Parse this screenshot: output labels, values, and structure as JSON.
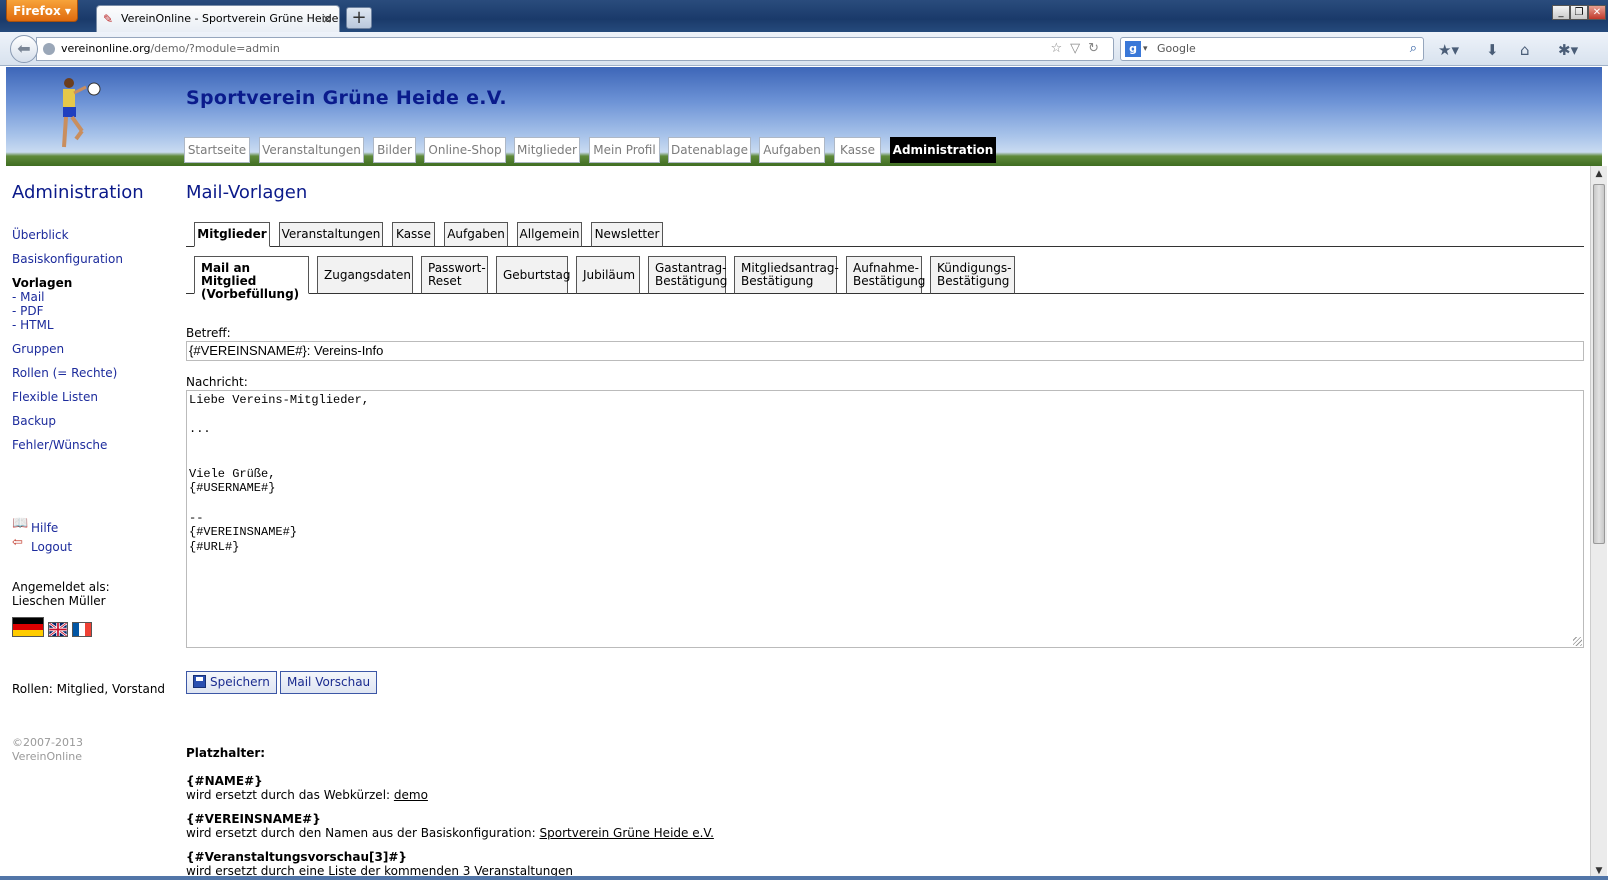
{
  "browser": {
    "app_button": "Firefox",
    "tab_title": "VereinOnline - Sportverein Grüne Heide e.V.",
    "new_tab": "+",
    "url_host": "vereinonline.org",
    "url_path": "/demo/?module=admin",
    "search_placeholder": "Google",
    "search_engine_glyph": "g"
  },
  "site": {
    "title": "Sportverein Grüne Heide e.V.",
    "nav": [
      "Startseite",
      "Veranstaltungen",
      "Bilder",
      "Online-Shop",
      "Mitglieder",
      "Mein Profil",
      "Datenablage",
      "Aufgaben",
      "Kasse",
      "Administration"
    ],
    "nav_active": "Administration"
  },
  "sidebar": {
    "heading": "Administration",
    "links": {
      "overview": "Überblick",
      "basisconfig": "Basiskonfiguration",
      "vorlagen": "Vorlagen",
      "mail": "- Mail",
      "pdf": "- PDF",
      "html": "- HTML",
      "gruppen": "Gruppen",
      "rollen": "Rollen (= Rechte)",
      "listen": "Flexible Listen",
      "backup": "Backup",
      "fehler": "Fehler/Wünsche"
    },
    "help": "Hilfe",
    "logout": "Logout",
    "logged_in_label": "Angemeldet als:",
    "user_name": "Lieschen Müller",
    "roles": "Rollen: Mitglied, Vorstand",
    "copyright_line1": "©2007-2013",
    "copyright_line2": "VereinOnline"
  },
  "content": {
    "page_title": "Mail-Vorlagen",
    "tabs_level1": [
      "Mitglieder",
      "Veranstaltungen",
      "Kasse",
      "Aufgaben",
      "Allgemein",
      "Newsletter"
    ],
    "tabs_level2": [
      "Mail an Mitglied\n(Vorbefüllung)",
      "Zugangsdaten",
      "Passwort-\nReset",
      "Geburtstag",
      "Jubiläum",
      "Gastantrag-\nBestätigung",
      "Mitgliedsantrag-\nBestätigung",
      "Aufnahme-\nBestätigung",
      "Kündigungs-\nBestätigung"
    ],
    "subject_label": "Betreff:",
    "subject_value": "{#VEREINSNAME#}: Vereins-Info",
    "message_label": "Nachricht:",
    "message_value": "Liebe Vereins-Mitglieder,\n\n...\n\n\nViele Grüße,\n{#USERNAME#}\n\n--\n{#VEREINSNAME#}\n{#URL#}",
    "save_button": "Speichern",
    "preview_button": "Mail Vorschau",
    "placeholder_title": "Platzhalter:",
    "placeholders": [
      {
        "name": "{#NAME#}",
        "desc": "wird ersetzt durch das Webkürzel: ",
        "link": "demo"
      },
      {
        "name": "{#VEREINSNAME#}",
        "desc": "wird ersetzt durch den Namen aus der Basiskonfiguration: ",
        "link": "Sportverein Grüne Heide e.V."
      },
      {
        "name": "{#Veranstaltungsvorschau[3]#}",
        "desc": "wird ersetzt durch eine Liste der kommenden 3 Veranstaltungen",
        "link": ""
      }
    ]
  }
}
